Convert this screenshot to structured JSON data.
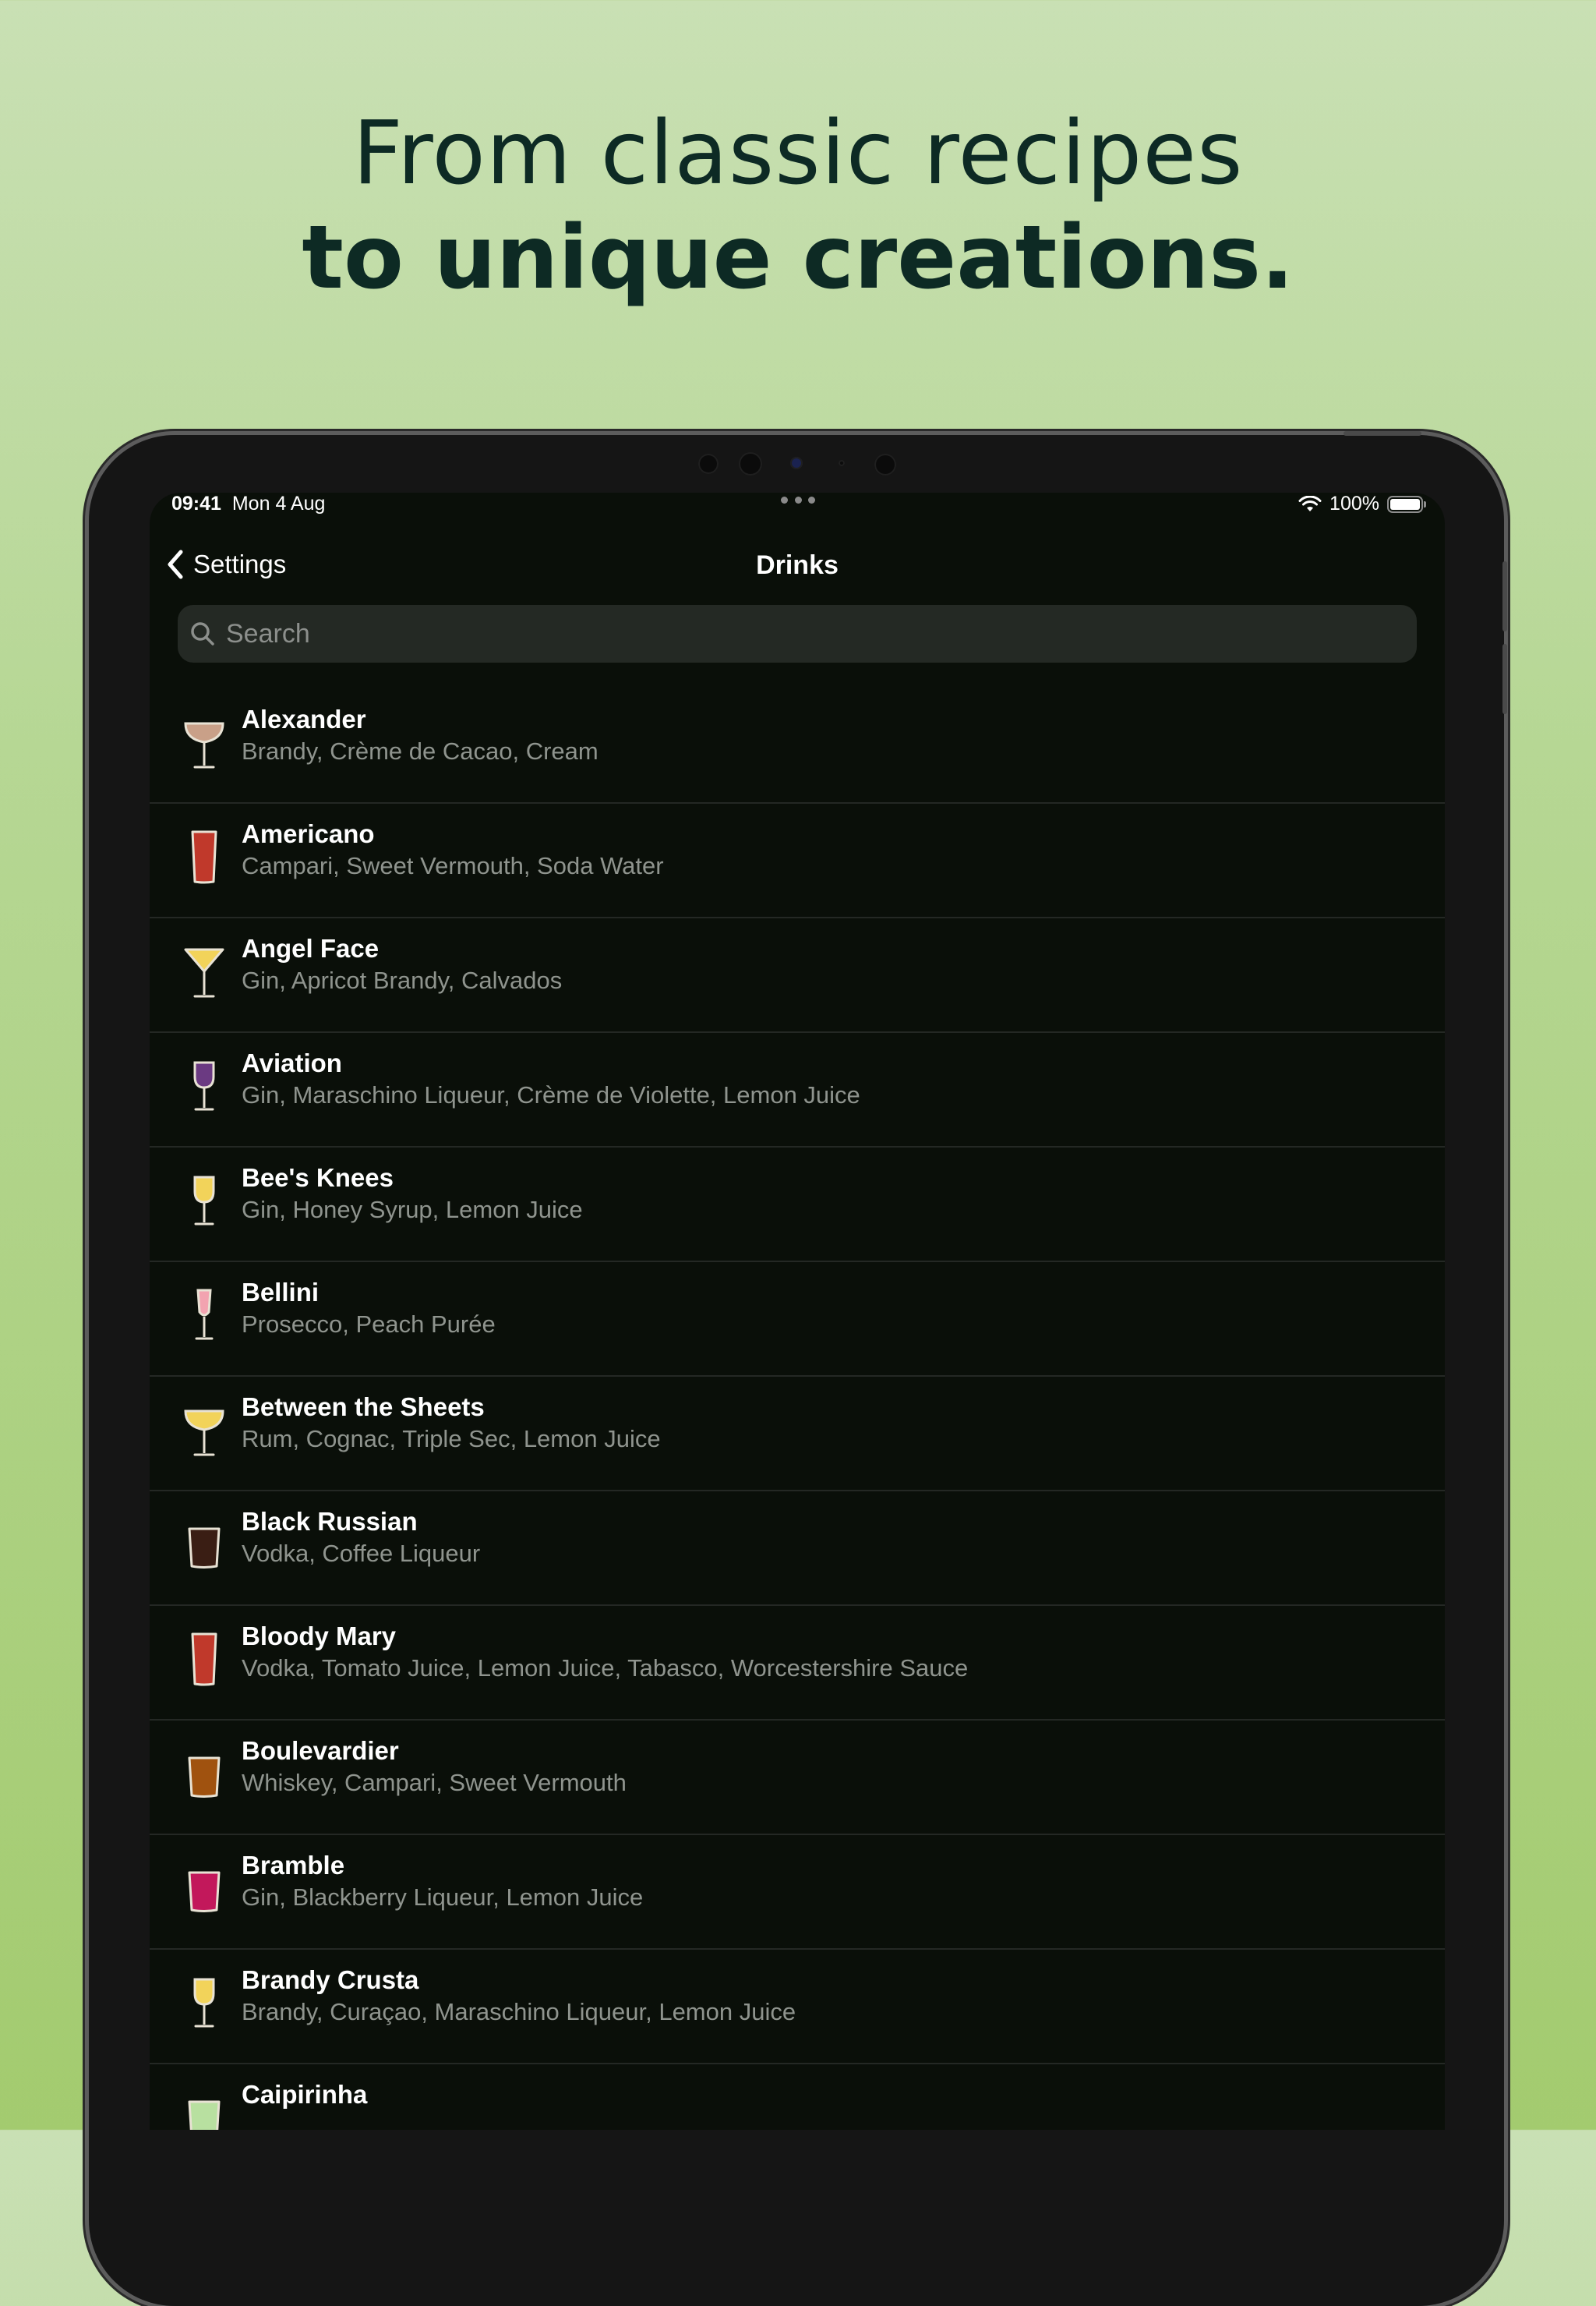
{
  "headline": {
    "line1": "From classic recipes",
    "line2": "to unique creations."
  },
  "status_bar": {
    "time": "09:41",
    "date": "Mon 4 Aug",
    "battery": "100%"
  },
  "nav": {
    "back_label": "Settings",
    "title": "Drinks"
  },
  "search": {
    "placeholder": "Search"
  },
  "drinks": [
    {
      "name": "Alexander",
      "ingredients": "Brandy, Crème de Cacao, Cream",
      "glass": "coupe",
      "color": "#c9a088"
    },
    {
      "name": "Americano",
      "ingredients": "Campari, Sweet Vermouth, Soda Water",
      "glass": "highball",
      "color": "#c0392b"
    },
    {
      "name": "Angel Face",
      "ingredients": "Gin, Apricot Brandy, Calvados",
      "glass": "martini",
      "color": "#f2d35a"
    },
    {
      "name": "Aviation",
      "ingredients": "Gin, Maraschino Liqueur, Crème de Violette, Lemon Juice",
      "glass": "wine",
      "color": "#6b3a82"
    },
    {
      "name": "Bee's Knees",
      "ingredients": "Gin, Honey Syrup, Lemon Juice",
      "glass": "wine",
      "color": "#f2d35a"
    },
    {
      "name": "Bellini",
      "ingredients": "Prosecco, Peach Purée",
      "glass": "flute",
      "color": "#f2a3b0"
    },
    {
      "name": "Between the Sheets",
      "ingredients": "Rum, Cognac, Triple Sec, Lemon Juice",
      "glass": "coupe",
      "color": "#f2d35a"
    },
    {
      "name": "Black Russian",
      "ingredients": "Vodka, Coffee Liqueur",
      "glass": "rocks",
      "color": "#3a1e14"
    },
    {
      "name": "Bloody Mary",
      "ingredients": "Vodka, Tomato Juice, Lemon Juice, Tabasco, Worcestershire Sauce",
      "glass": "highball",
      "color": "#c0392b"
    },
    {
      "name": "Boulevardier",
      "ingredients": "Whiskey, Campari, Sweet Vermouth",
      "glass": "rocks",
      "color": "#a0520f"
    },
    {
      "name": "Bramble",
      "ingredients": "Gin, Blackberry Liqueur, Lemon Juice",
      "glass": "rocks",
      "color": "#c2185b"
    },
    {
      "name": "Brandy Crusta",
      "ingredients": "Brandy, Curaçao, Maraschino Liqueur, Lemon Juice",
      "glass": "wine",
      "color": "#f2d35a"
    },
    {
      "name": "Caipirinha",
      "ingredients": "",
      "glass": "rocks",
      "color": "#b8e0a0"
    }
  ]
}
